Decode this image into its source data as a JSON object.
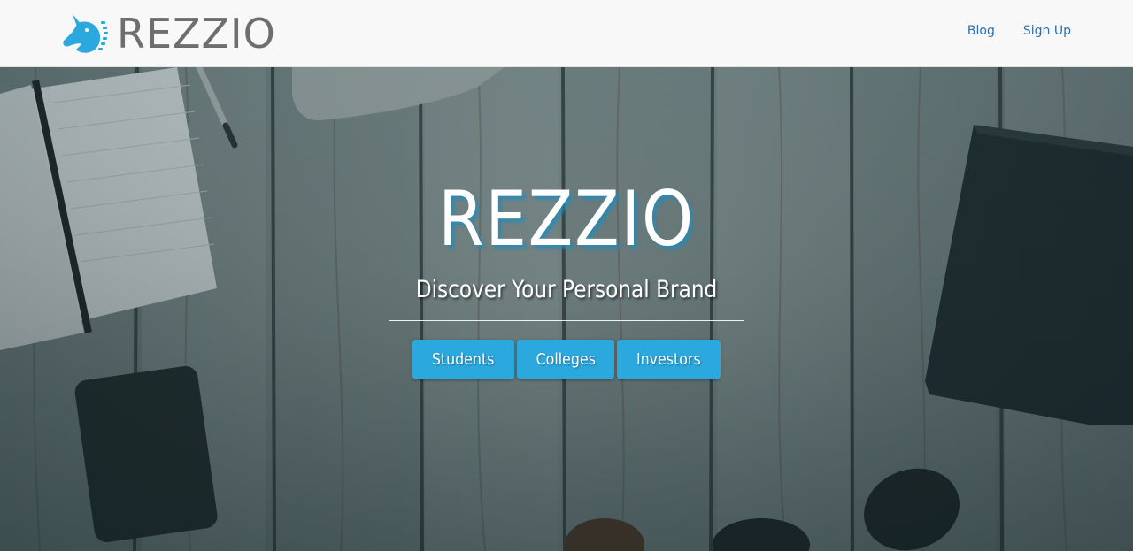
{
  "colors": {
    "brand_blue": "#2ba9df",
    "nav_link": "#2a6fb0",
    "brand_text": "#6e6e6e",
    "navbar_bg": "#f8f8f8"
  },
  "navbar": {
    "logo_icon": "unicorn-head-icon",
    "brand": "REZZIO",
    "links": [
      {
        "label": "Blog"
      },
      {
        "label": "Sign Up"
      }
    ]
  },
  "hero": {
    "background_icon": "wooden-desk-photo",
    "title": "REZZIO",
    "subtitle": "Discover Your Personal Brand",
    "buttons": [
      {
        "label": "Students"
      },
      {
        "label": "Colleges"
      },
      {
        "label": "Investors"
      }
    ]
  }
}
